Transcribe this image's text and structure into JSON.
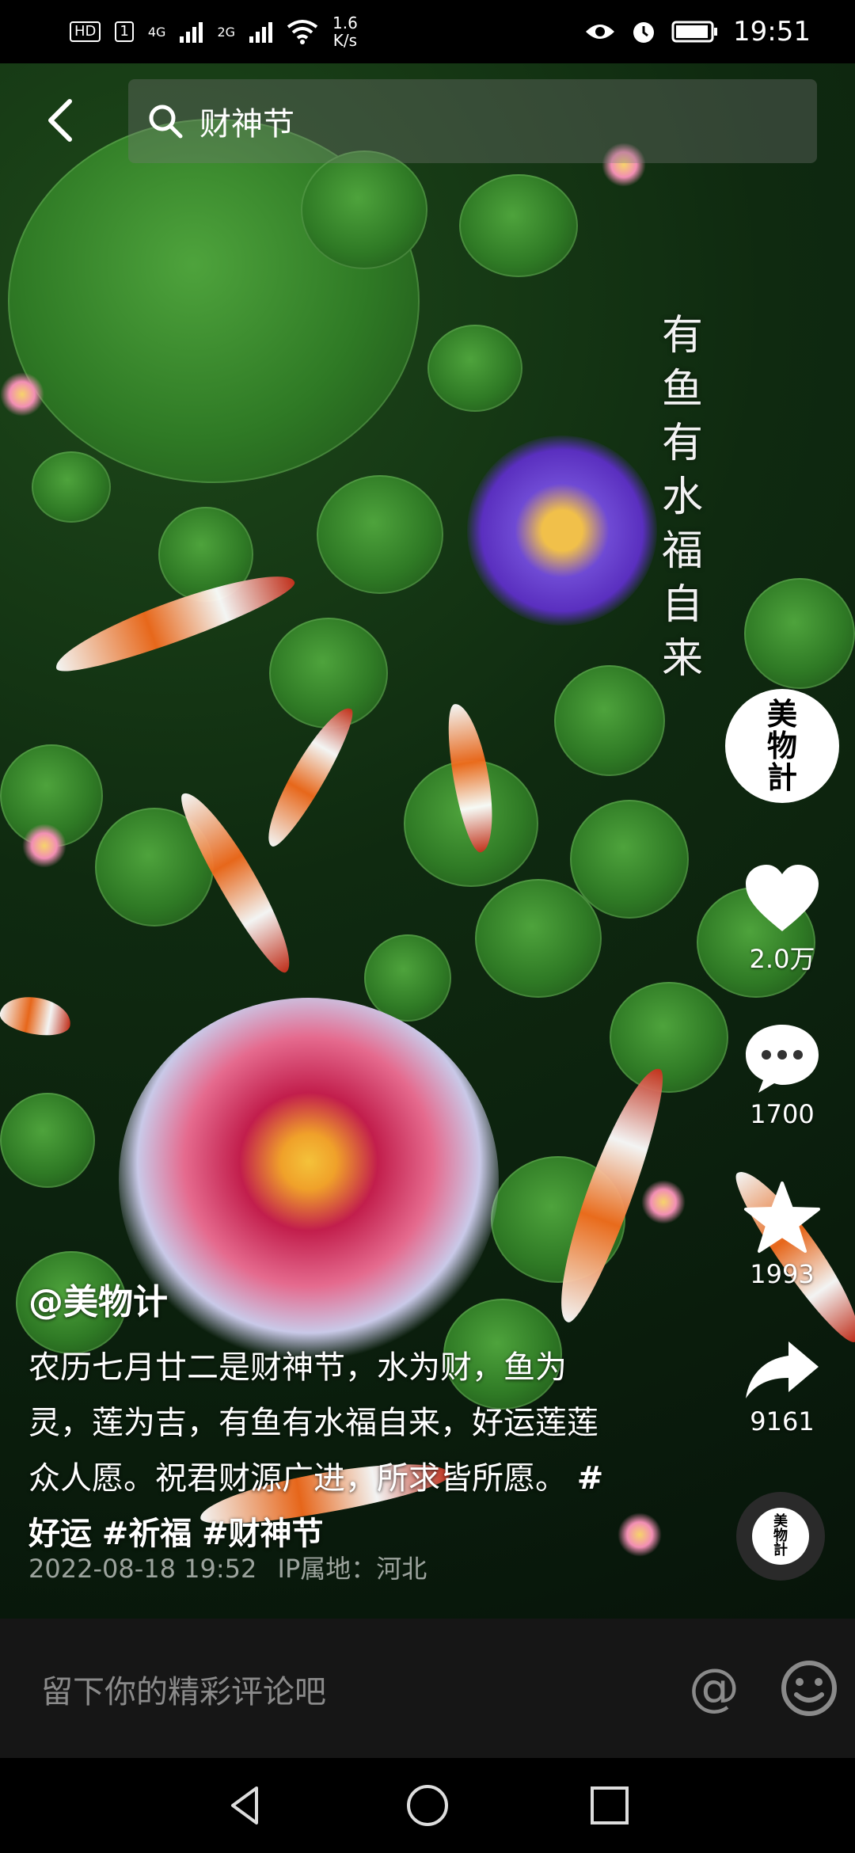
{
  "status_bar": {
    "network_hd": "HD",
    "sim_slot": "1",
    "net_1": "4G",
    "net_2": "2G",
    "speed_value": "1.6",
    "speed_unit": "K/s",
    "time": "19:51"
  },
  "search": {
    "query": "财神节"
  },
  "overlay": {
    "vertical_text": [
      "有",
      "鱼",
      "有",
      "水",
      "福",
      "自",
      "来"
    ]
  },
  "account": {
    "avatar_text": "美物計",
    "disc_text": "美物計"
  },
  "actions": {
    "likes": "2.0万",
    "comments": "1700",
    "favorites": "1993",
    "shares": "9161"
  },
  "post": {
    "author": "@美物计",
    "description": "农历七月廿二是财神节，水为财，鱼为灵，莲为吉，有鱼有水福自来，好运莲莲众人愿。祝君财源广进，所求皆所愿。",
    "tags": [
      "#好运",
      "#祈福",
      "#财神节"
    ],
    "datetime": "2022-08-18 19:52",
    "ip_location": "IP属地：河北"
  },
  "comment_bar": {
    "placeholder": "留下你的精彩评论吧",
    "at_symbol": "@"
  },
  "colors": {
    "background": "#000000",
    "comment_bar": "#161616",
    "placeholder": "#8a8a8a"
  }
}
